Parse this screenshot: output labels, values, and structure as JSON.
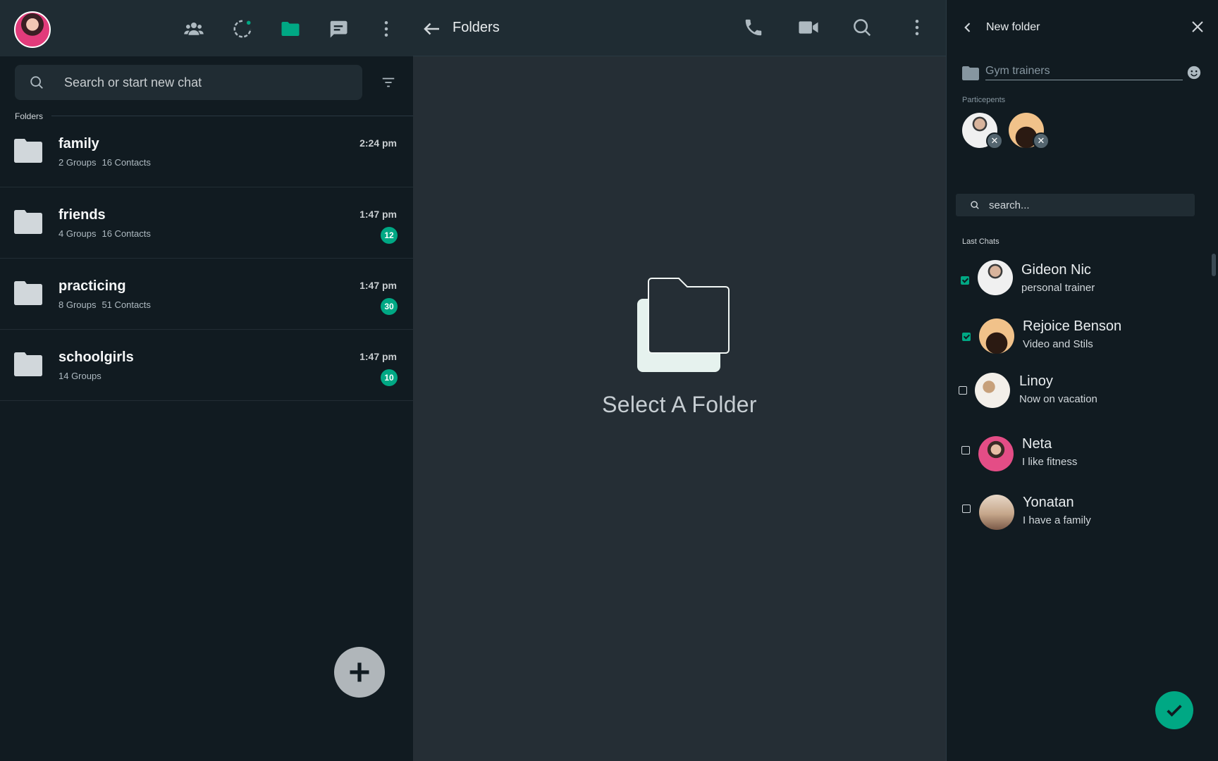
{
  "left_panel": {
    "header_icons": [
      "community-icon",
      "status-icon",
      "folder-icon",
      "chat-icon",
      "menu-icon"
    ],
    "search": {
      "placeholder": "Search or start new chat"
    },
    "folders_label": "Folders",
    "folders": [
      {
        "name": "family",
        "groups": "2 Groups",
        "contacts": "16 Contacts",
        "time": "2:24 pm",
        "badge": ""
      },
      {
        "name": "friends",
        "groups": "4 Groups",
        "contacts": "16 Contacts",
        "time": "1:47 pm",
        "badge": "12"
      },
      {
        "name": "practicing",
        "groups": "8 Groups",
        "contacts": "51 Contacts",
        "time": "1:47 pm",
        "badge": "30"
      },
      {
        "name": "schoolgirls",
        "groups": "14 Groups",
        "contacts": "",
        "time": "1:47 pm",
        "badge": "10"
      }
    ]
  },
  "middle_panel": {
    "title": "Folders",
    "empty_text": "Select A Folder"
  },
  "right_panel": {
    "title": "New folder",
    "folder_name_placeholder": "Gym trainers",
    "participants_label": "Particepents",
    "search_placeholder": "search...",
    "last_chats_label": "Last Chats",
    "contacts": [
      {
        "name": "Gideon Nic",
        "status": "personal trainer",
        "checked": true
      },
      {
        "name": "Rejoice Benson",
        "status": "Video and Stils",
        "checked": true
      },
      {
        "name": "Linoy",
        "status": "Now on vacation",
        "checked": false
      },
      {
        "name": "Neta",
        "status": "I like fitness",
        "checked": false
      },
      {
        "name": "Yonatan",
        "status": "I have a family",
        "checked": false
      }
    ]
  },
  "colors": {
    "accent": "#00a884",
    "panel_dark": "#111b21",
    "header": "#1f2c33",
    "middle_bg": "#252e35"
  }
}
